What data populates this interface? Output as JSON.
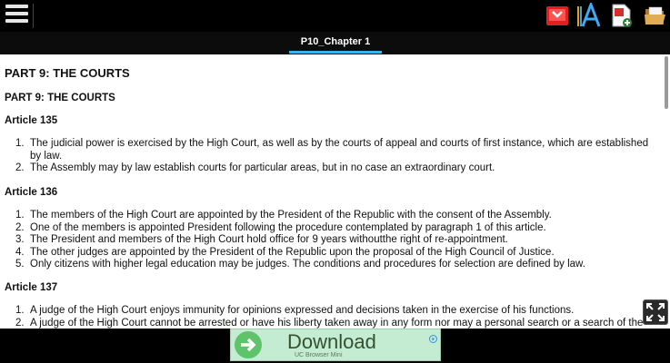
{
  "toolbar": {
    "menu_icon": "hamburger-menu-icon",
    "icons": [
      "bookmark-icon",
      "font-size-icon",
      "pdf-export-icon",
      "folder-open-icon"
    ]
  },
  "tab": {
    "label": "P10_Chapter 1"
  },
  "document": {
    "title": "PART 9: THE COURTS",
    "subtitle": "PART 9: THE COURTS",
    "articles": [
      {
        "heading": "Article 135",
        "items": [
          "The judicial power is exercised by the High Court, as well as by the courts of appeal and courts of first instance, which are established by law.",
          "The Assembly may by law establish courts for particular areas, but in no case an extraordinary court."
        ]
      },
      {
        "heading": "Article 136",
        "items": [
          "The members of the High Court are appointed by the President of the Republic with the consent of the Assembly.",
          "One of the members is appointed President following the procedure contemplated by paragraph 1 of this article.",
          "The President and members of the High Court hold office for 9 years withoutthe right of re-appointment.",
          "The other judges are appointed by the President of the Republic upon the proposal of the High Council of Justice.",
          "Only citizens with higher legal education may be judges. The conditions and procedures for selection are defined by law."
        ]
      },
      {
        "heading": "Article 137",
        "items": [
          "A judge of the High Court enjoys immunity for opinions expressed and decisions taken in the exercise of his functions.",
          "A judge of the High Court cannot be arrested or have his liberty taken away in any form nor may a personal search or a search of the"
        ]
      }
    ]
  },
  "fullscreen": {
    "icon": "fullscreen-icon"
  },
  "ad": {
    "title": "Download",
    "subtitle": "UC Browser Mini",
    "colors": {
      "background": "#c4ecd2",
      "arrow": "#5fc36c"
    }
  },
  "colors": {
    "accent": "#33b5e5",
    "bar": "#000000"
  }
}
